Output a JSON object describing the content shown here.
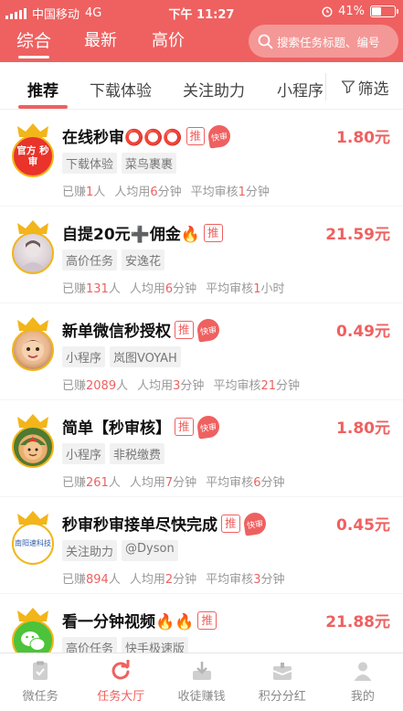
{
  "status_bar": {
    "carrier": "中国移动",
    "network": "4G",
    "time": "下午 11:27",
    "battery": "41%",
    "battery_level": 0.41
  },
  "top_nav": {
    "tabs": [
      {
        "label": "综合",
        "active": true
      },
      {
        "label": "最新",
        "active": false
      },
      {
        "label": "高价",
        "active": false
      }
    ],
    "search_placeholder": "搜索任务标题、编号"
  },
  "sub_tabs": {
    "tabs": [
      {
        "label": "推荐",
        "active": true
      },
      {
        "label": "下载体验",
        "active": false
      },
      {
        "label": "关注助力",
        "active": false
      },
      {
        "label": "小程序",
        "active": false
      }
    ],
    "filter_label": "筛选"
  },
  "tasks": [
    {
      "title": "在线秒审⭕⭕⭕",
      "badge_tui": "推",
      "badge_fast": "快审",
      "price": "1.80元",
      "tags": [
        "下载体验",
        "菜鸟裹裹"
      ],
      "avatar_text": "官方 秒审",
      "earned_prefix": "已赚",
      "earned_count": "1",
      "earned_suffix": "人",
      "avg_prefix": "人均用",
      "avg_value": "6",
      "avg_unit": "分钟",
      "review_prefix": "平均审核",
      "review_value": "1",
      "review_unit": "分钟",
      "icon": "official-instant-review-avatar"
    },
    {
      "title": "自提20元➕佣金🔥",
      "badge_tui": "推",
      "badge_fast": "",
      "price": "21.59元",
      "tags": [
        "高价任务",
        "安逸花"
      ],
      "avatar_text": "",
      "earned_prefix": "已赚",
      "earned_count": "131",
      "earned_suffix": "人",
      "avg_prefix": "人均用",
      "avg_value": "6",
      "avg_unit": "分钟",
      "review_prefix": "平均审核",
      "review_value": "1",
      "review_unit": "小时",
      "icon": "user-photo-avatar"
    },
    {
      "title": "新单微信秒授权",
      "badge_tui": "推",
      "badge_fast": "快审",
      "price": "0.49元",
      "tags": [
        "小程序",
        "岚图VOYAH"
      ],
      "avatar_text": "",
      "earned_prefix": "已赚",
      "earned_count": "2089",
      "earned_suffix": "人",
      "avg_prefix": "人均用",
      "avg_value": "3",
      "avg_unit": "分钟",
      "review_prefix": "平均审核",
      "review_value": "21",
      "review_unit": "分钟",
      "icon": "child-photo-avatar"
    },
    {
      "title": "简单【秒审核】",
      "badge_tui": "推",
      "badge_fast": "快审",
      "price": "1.80元",
      "tags": [
        "小程序",
        "非税缴费"
      ],
      "avatar_text": "",
      "earned_prefix": "已赚",
      "earned_count": "261",
      "earned_suffix": "人",
      "avg_prefix": "人均用",
      "avg_value": "7",
      "avg_unit": "分钟",
      "review_prefix": "平均审核",
      "review_value": "6",
      "review_unit": "分钟",
      "icon": "cartoon-soldier-avatar"
    },
    {
      "title": "秒审秒审接单尽快完成",
      "badge_tui": "推",
      "badge_fast": "快审",
      "price": "0.45元",
      "tags": [
        "关注助力",
        "@Dyson"
      ],
      "avatar_text": "南阳速科技",
      "earned_prefix": "已赚",
      "earned_count": "894",
      "earned_suffix": "人",
      "avg_prefix": "人均用",
      "avg_value": "2",
      "avg_unit": "分钟",
      "review_prefix": "平均审核",
      "review_value": "3",
      "review_unit": "分钟",
      "icon": "company-logo-avatar"
    },
    {
      "title": "看一分钟视频🔥🔥",
      "badge_tui": "推",
      "badge_fast": "",
      "price": "21.88元",
      "tags": [
        "高价任务",
        "快手极速版"
      ],
      "avatar_text": "",
      "earned_prefix": "",
      "earned_count": "",
      "earned_suffix": "",
      "avg_prefix": "",
      "avg_value": "",
      "avg_unit": "",
      "review_prefix": "",
      "review_value": "",
      "review_unit": "",
      "icon": "wechat-avatar"
    }
  ],
  "bottom_nav": {
    "items": [
      {
        "label": "微任务",
        "icon": "clipboard-icon",
        "active": false
      },
      {
        "label": "任务大厅",
        "icon": "refresh-icon",
        "active": true
      },
      {
        "label": "收徒赚钱",
        "icon": "download-tray-icon",
        "active": false
      },
      {
        "label": "积分分红",
        "icon": "gift-box-icon",
        "active": false
      },
      {
        "label": "我的",
        "icon": "person-icon",
        "active": false
      }
    ]
  },
  "colors": {
    "brand": "#ee6160",
    "crown_gold": "#f2b51a",
    "muted_text": "#999999"
  }
}
